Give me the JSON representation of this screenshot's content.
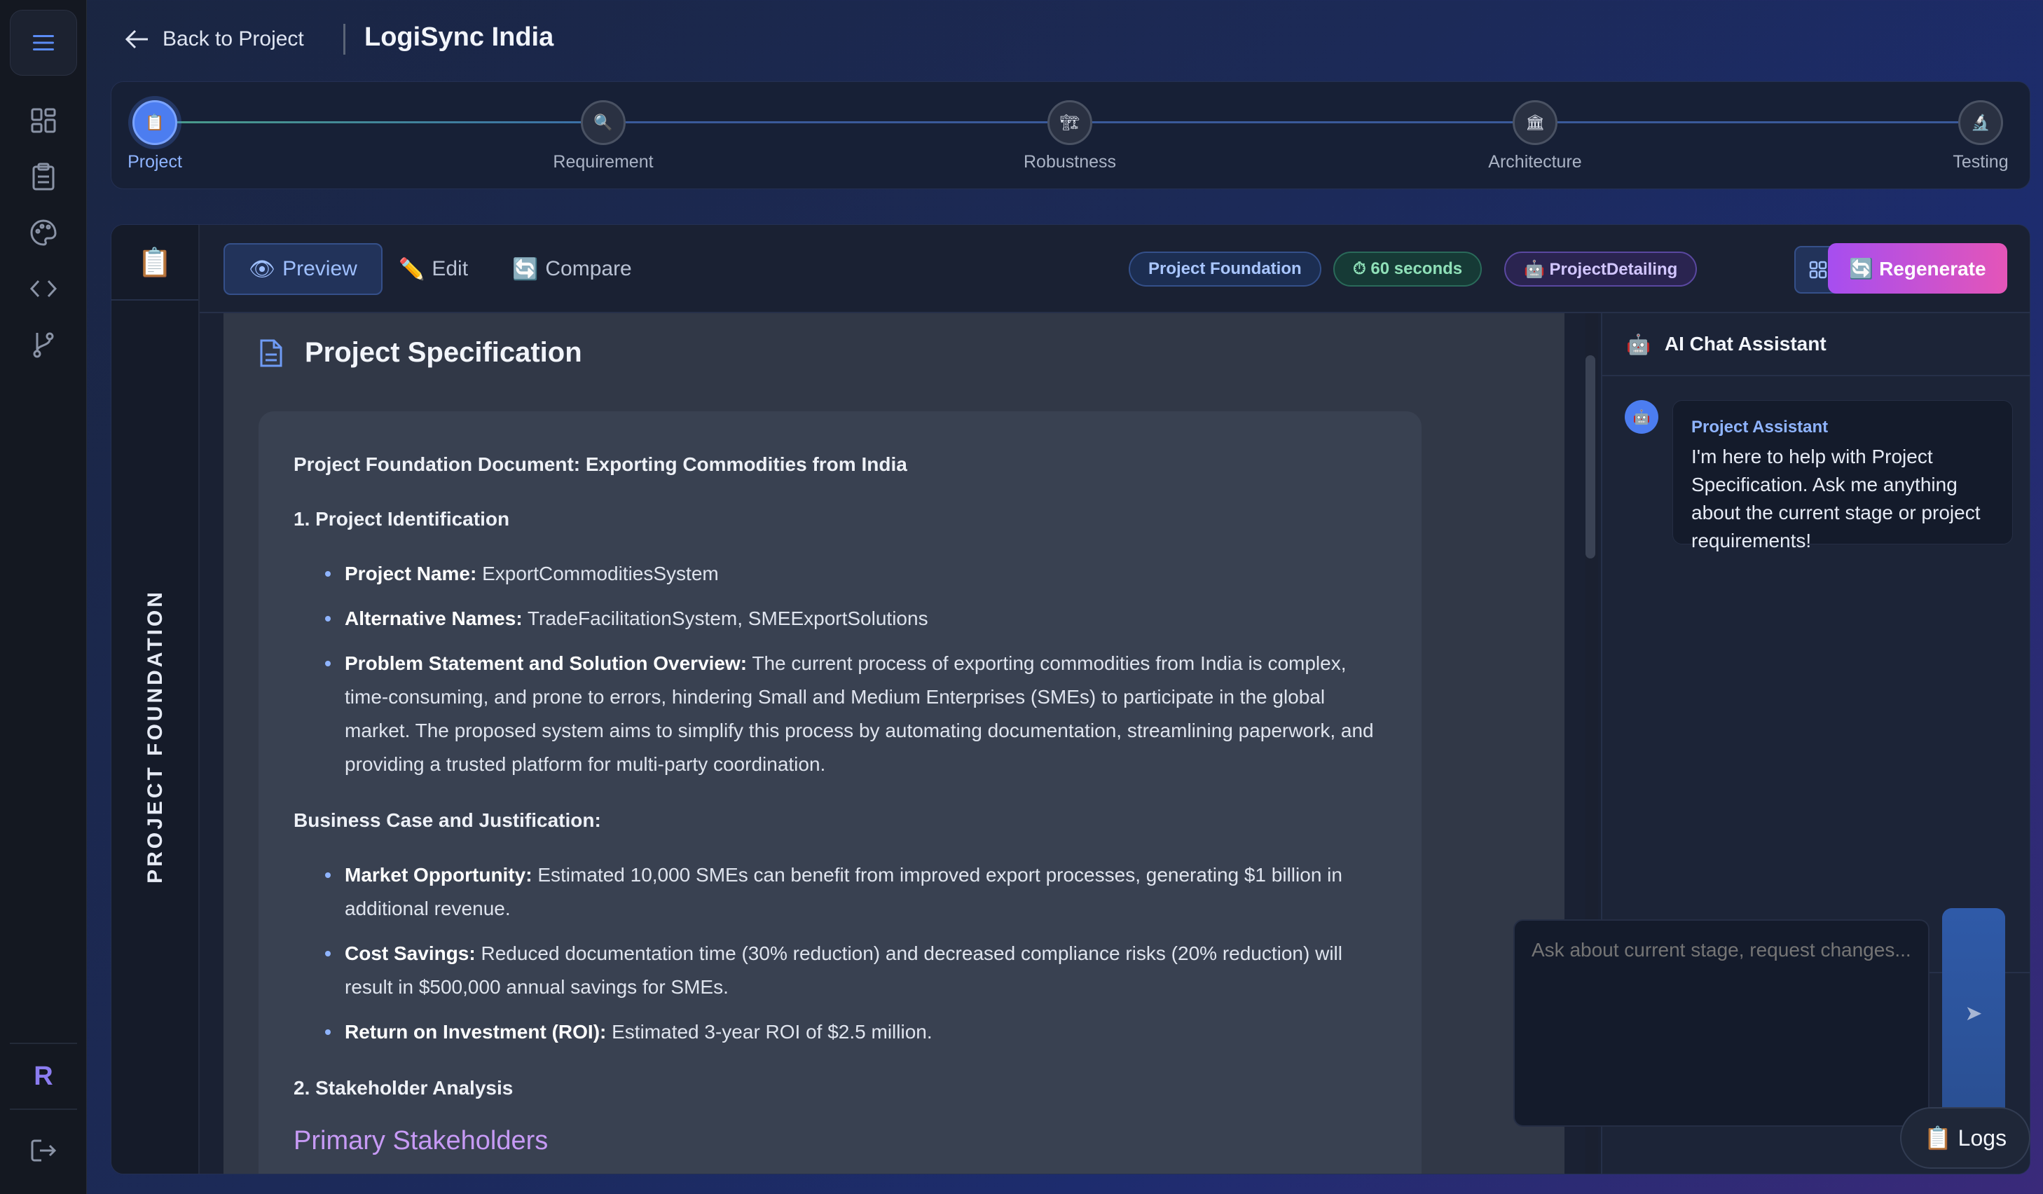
{
  "header": {
    "back_label": "Back to Project",
    "project_title": "LogiSync India"
  },
  "stepper": {
    "steps": [
      {
        "label": "Project",
        "icon": "📋"
      },
      {
        "label": "Requirement",
        "icon": "🔍"
      },
      {
        "label": "Robustness",
        "icon": "🏗"
      },
      {
        "label": "Architecture",
        "icon": "🏛"
      },
      {
        "label": "Testing",
        "icon": "🔬"
      }
    ]
  },
  "sidebar_vertical": {
    "icon": "📋",
    "label": "PROJECT FOUNDATION"
  },
  "toolbar": {
    "tabs": [
      {
        "icon": "👁",
        "label": "Preview"
      },
      {
        "icon": "✏️",
        "label": "Edit"
      },
      {
        "icon": "🔄",
        "label": "Compare"
      }
    ],
    "badges": {
      "stage": "Project Foundation",
      "time": "⏱ 60 seconds",
      "agent": "🤖 ProjectDetailing"
    },
    "regenerate_label": "🔄 Regenerate"
  },
  "document": {
    "title": "Project Specification",
    "heading": "Project Foundation Document: Exporting Commodities from India",
    "section1": "1. Project Identification",
    "s1_items": [
      {
        "label": "Project Name:",
        "text": " ExportCommoditiesSystem"
      },
      {
        "label": "Alternative Names:",
        "text": " TradeFacilitationSystem, SMEExportSolutions"
      },
      {
        "label": "Problem Statement and Solution Overview:",
        "text": " The current process of exporting commodities from India is complex, time-consuming, and prone to errors, hindering Small and Medium Enterprises (SMEs) to participate in the global market. The proposed system aims to simplify this process by automating documentation, streamlining paperwork, and providing a trusted platform for multi-party coordination."
      }
    ],
    "business_case": "Business Case and Justification:",
    "bc_items": [
      {
        "label": "Market Opportunity:",
        "text": " Estimated 10,000 SMEs can benefit from improved export processes, generating $1 billion in additional revenue."
      },
      {
        "label": "Cost Savings:",
        "text": " Reduced documentation time (30% reduction) and decreased compliance risks (20% reduction) will result in $500,000 annual savings for SMEs."
      },
      {
        "label": "Return on Investment (ROI):",
        "text": " Estimated 3-year ROI of $2.5 million."
      }
    ],
    "section2": "2. Stakeholder Analysis",
    "subheading": "Primary Stakeholders"
  },
  "chat": {
    "title": "AI Chat Assistant",
    "title_icon": "🤖",
    "avatar_icon": "🤖",
    "sender": "Project Assistant",
    "message": "I'm here to help with Project Specification. Ask me anything about the current stage or project requirements!",
    "input_placeholder": "Ask about current stage, request changes...",
    "send_icon": "➤"
  },
  "rail": {
    "logo_letter": "R"
  },
  "logs_label": "📋 Logs",
  "colors": {
    "accent": "#4c7df0",
    "regenerate_from": "#a64ef0",
    "regenerate_to": "#e455b8"
  }
}
